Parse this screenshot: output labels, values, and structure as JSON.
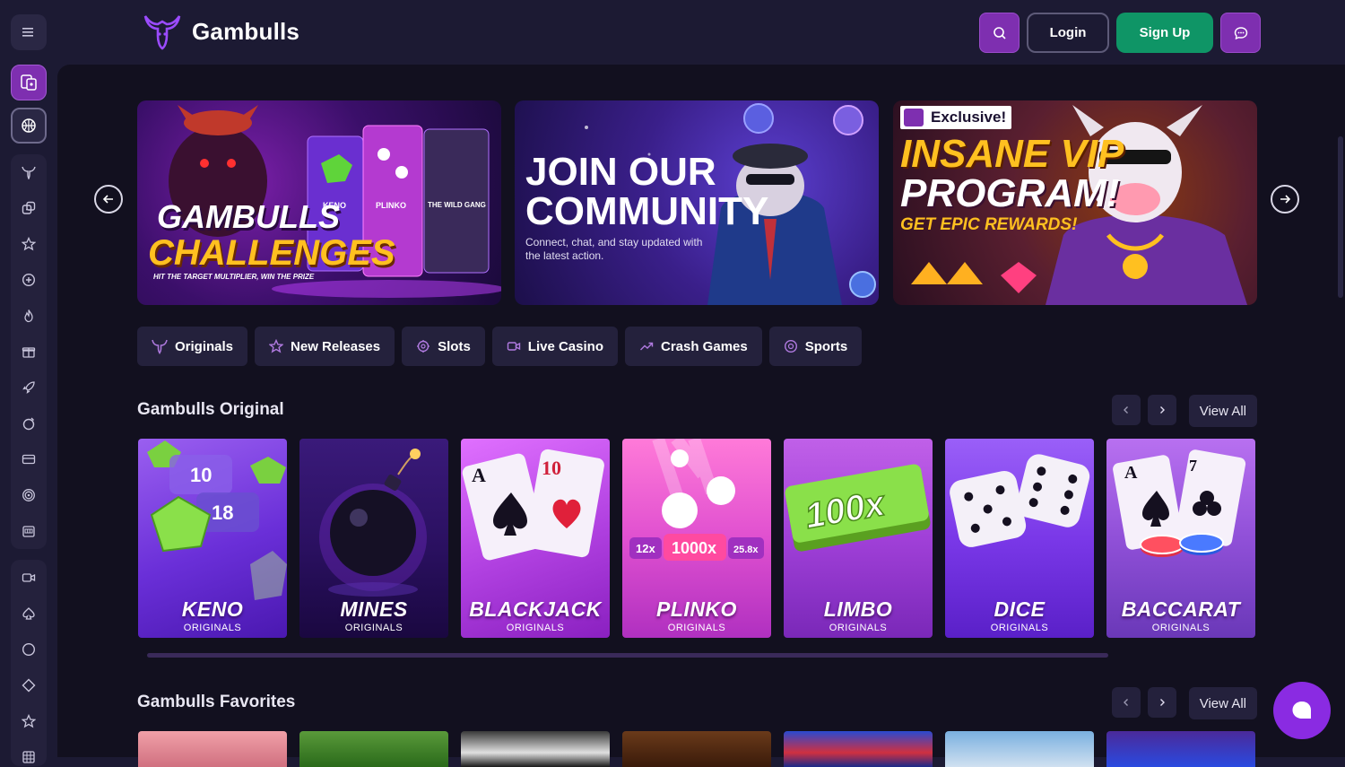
{
  "header": {
    "brand": "Gambulls",
    "login_label": "Login",
    "signup_label": "Sign Up"
  },
  "banners": [
    {
      "title_line1": "GAMBULLS",
      "title_line2": "CHALLENGES",
      "tagline": "HIT THE TARGET MULTIPLIER, WIN THE PRIZE",
      "cards": [
        "KENO",
        "PLINKO",
        "THE WILD GANG"
      ]
    },
    {
      "title_line1": "JOIN OUR",
      "title_line2": "COMMUNITY",
      "subtitle": "Connect, chat, and stay updated with the latest action."
    },
    {
      "badge": "Exclusive!",
      "title_line1": "INSANE VIP",
      "title_line2": "PROGRAM!",
      "subtitle": "GET EPIC REWARDS!"
    }
  ],
  "categories": [
    {
      "label": "Originals",
      "icon": "bull-icon"
    },
    {
      "label": "New Releases",
      "icon": "star-icon"
    },
    {
      "label": "Slots",
      "icon": "slots-icon"
    },
    {
      "label": "Live Casino",
      "icon": "video-icon"
    },
    {
      "label": "Crash Games",
      "icon": "trend-icon"
    },
    {
      "label": "Sports",
      "icon": "ball-icon"
    }
  ],
  "originals": {
    "title": "Gambulls Original",
    "view_all": "View All",
    "games": [
      {
        "name": "KENO",
        "sub": "ORIGINALS",
        "art": "10 18"
      },
      {
        "name": "MINES",
        "sub": "ORIGINALS"
      },
      {
        "name": "BLACKJACK",
        "sub": "ORIGINALS"
      },
      {
        "name": "PLINKO",
        "sub": "ORIGINALS",
        "art": "1000x"
      },
      {
        "name": "LIMBO",
        "sub": "ORIGINALS",
        "art": "100x"
      },
      {
        "name": "DICE",
        "sub": "ORIGINALS"
      },
      {
        "name": "BACCARAT",
        "sub": "ORIGINALS"
      }
    ]
  },
  "favorites": {
    "title": "Gambulls Favorites",
    "view_all": "View All"
  },
  "colors": {
    "accent": "#7e2fb0",
    "signup": "#0f9566",
    "bg": "#12101f",
    "panel": "#24213c"
  }
}
